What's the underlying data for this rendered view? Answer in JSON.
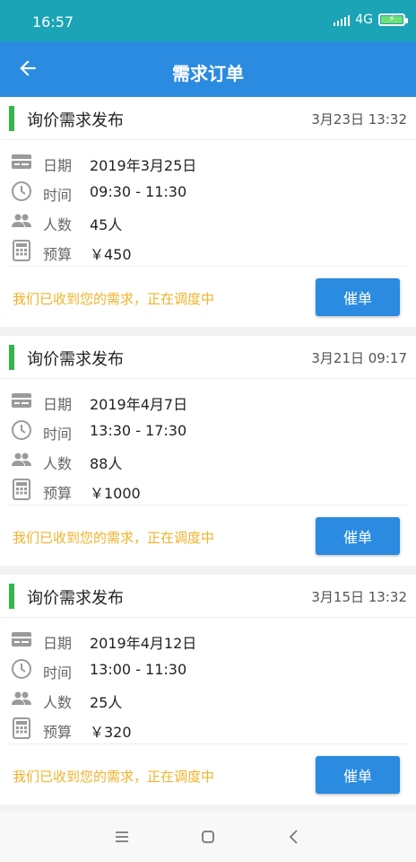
{
  "status": {
    "time": "16:57",
    "network": "4G"
  },
  "appbar": {
    "title": "需求订单"
  },
  "orders": [
    {
      "title": "询价需求发布",
      "datetime": "3月23日 13:32",
      "date_label": "日期",
      "date": "2019年3月25日",
      "time_label": "时间",
      "time": "09:30 - 11:30",
      "people_label": "人数",
      "people": "45人",
      "budget_label": "预算",
      "budget": "￥450",
      "status": "我们已收到您的需求，正在调度中",
      "action": "催单"
    },
    {
      "title": "询价需求发布",
      "datetime": "3月21日 09:17",
      "date_label": "日期",
      "date": "2019年4月7日",
      "time_label": "时间",
      "time": "13:30 - 17:30",
      "people_label": "人数",
      "people": "88人",
      "budget_label": "预算",
      "budget": "￥1000",
      "status": "我们已收到您的需求，正在调度中",
      "action": "催单"
    },
    {
      "title": "询价需求发布",
      "datetime": "3月15日 13:32",
      "date_label": "日期",
      "date": "2019年4月12日",
      "time_label": "时间",
      "time": "13:00 - 11:30",
      "people_label": "人数",
      "people": "25人",
      "budget_label": "预算",
      "budget": "￥320",
      "status": "我们已收到您的需求，正在调度中",
      "action": "催单"
    }
  ],
  "colors": {
    "primary": "#2b8be0",
    "status_bar": "#1aa4b5",
    "accent_green": "#35b54a",
    "status_text": "#f0b32b"
  },
  "icons": {
    "date": "card-icon",
    "time": "clock-icon",
    "people": "people-icon",
    "budget": "calculator-icon"
  }
}
